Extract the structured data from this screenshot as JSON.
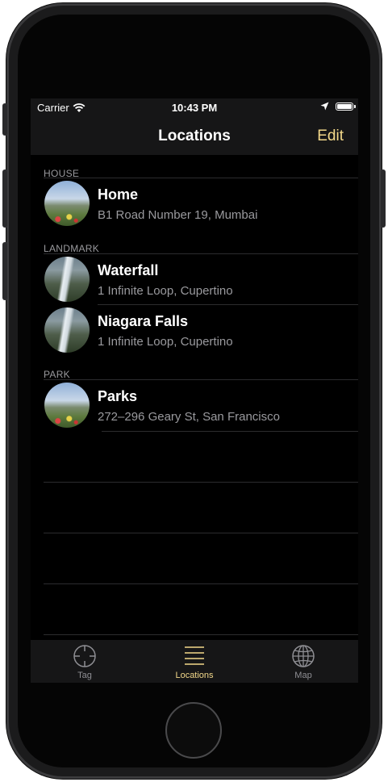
{
  "status_bar": {
    "carrier": "Carrier",
    "time": "10:43 PM"
  },
  "nav": {
    "title": "Locations",
    "edit_label": "Edit"
  },
  "sections": [
    {
      "header": "HOUSE",
      "rows": [
        {
          "title": "Home",
          "subtitle": "B1 Road Number 19, Mumbai",
          "image": "meadow-photo"
        }
      ]
    },
    {
      "header": "LANDMARK",
      "rows": [
        {
          "title": "Waterfall",
          "subtitle": "1 Infinite Loop, Cupertino",
          "image": "waterfall-photo"
        },
        {
          "title": "Niagara Falls",
          "subtitle": "1 Infinite Loop, Cupertino",
          "image": "waterfall-photo"
        }
      ]
    },
    {
      "header": "PARK",
      "rows": [
        {
          "title": "Parks",
          "subtitle": "272–296 Geary St, San Francisco",
          "image": "meadow-photo"
        }
      ]
    }
  ],
  "tabs": [
    {
      "label": "Tag",
      "icon": "crosshair-icon",
      "active": false
    },
    {
      "label": "Locations",
      "icon": "list-icon",
      "active": true
    },
    {
      "label": "Map",
      "icon": "globe-icon",
      "active": false
    }
  ],
  "colors": {
    "accent": "#f3d88a",
    "background": "#000000",
    "bar": "#161617",
    "secondary_text": "#9a9a9e"
  }
}
